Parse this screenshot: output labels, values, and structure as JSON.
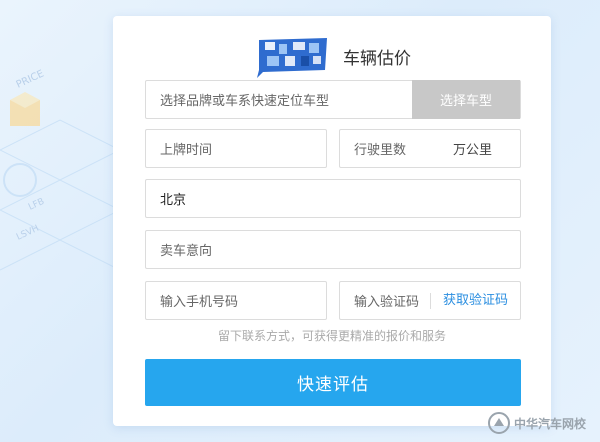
{
  "background": {
    "deco_text_1": "PRICE",
    "deco_text_2": "LFB",
    "deco_text_3": "LSVH"
  },
  "header": {
    "title": "车辆估价",
    "logo_icon": "qr-code-logo"
  },
  "form": {
    "brand_placeholder": "选择品牌或车系快速定位车型",
    "select_model_label": "选择车型",
    "reg_time_placeholder": "上牌时间",
    "mileage_placeholder": "行驶里数",
    "mileage_unit": "万公里",
    "city_value": "北京",
    "intent_placeholder": "卖车意向",
    "phone_placeholder": "输入手机号码",
    "code_placeholder": "输入验证码",
    "get_code_label": "获取验证码",
    "hint": "留下联系方式，可获得更精准的报价和服务",
    "submit_label": "快速评估"
  },
  "watermark": {
    "text": "中华汽车网校"
  },
  "colors": {
    "accent": "#26a6ee",
    "link": "#2a8ee0",
    "disabled": "#c8c8c8"
  }
}
